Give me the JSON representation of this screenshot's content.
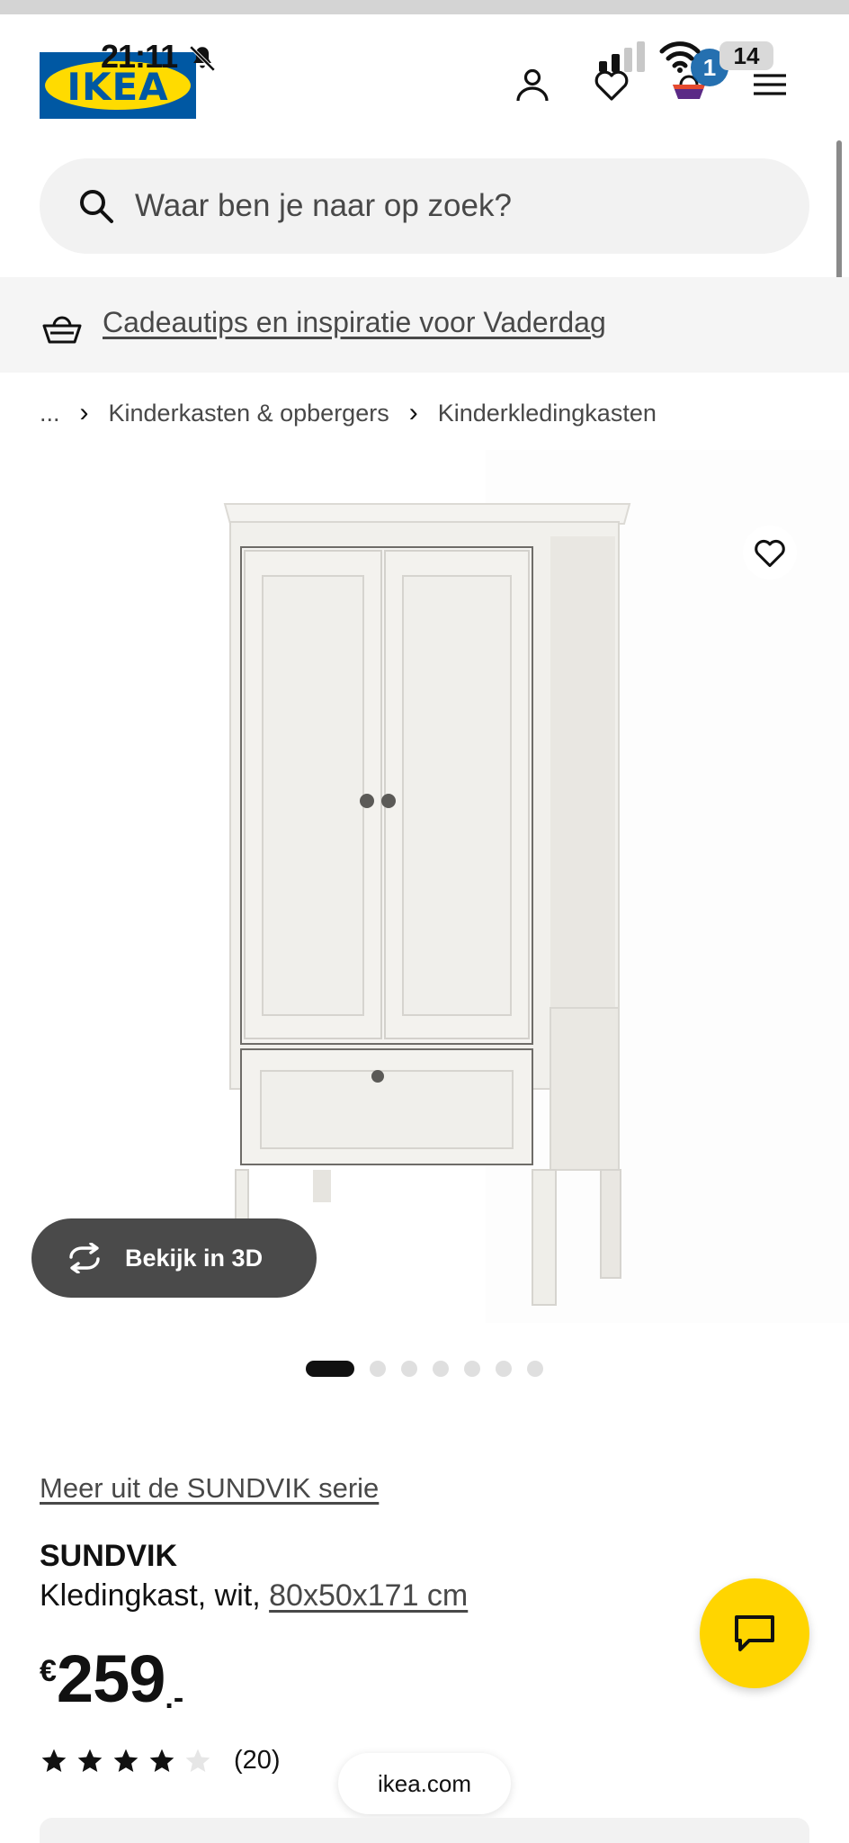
{
  "status_bar": {
    "time": "21:11",
    "battery": "14"
  },
  "header": {
    "logo_text": "IKEA",
    "cart_count": "1",
    "icons": [
      "account-icon",
      "heart-icon",
      "cart-icon",
      "menu-icon"
    ]
  },
  "search": {
    "placeholder": "Waar ben je naar op zoek?"
  },
  "promo": {
    "link": "Cadeautips en inspiratie voor Vaderdag"
  },
  "breadcrumb": {
    "ellipsis": "...",
    "items": [
      "Kinderkasten & opbergers",
      "Kinderkledingkasten"
    ]
  },
  "product": {
    "view_3d_label": "Bekijk in 3D",
    "image_count": 7,
    "active_image": 1,
    "series_link": "Meer uit de SUNDVIK serie",
    "name": "SUNDVIK",
    "description_prefix": "Kledingkast, wit, ",
    "dimensions": "80x50x171 cm",
    "price_currency": "€",
    "price_amount": "259",
    "price_suffix": ".-",
    "rating_value": 4,
    "rating_max": 5,
    "review_count": "(20)"
  },
  "browser": {
    "url": "ikea.com"
  },
  "colors": {
    "ikea_blue": "#0058a3",
    "ikea_yellow": "#ffdb00",
    "chat_yellow": "#ffd500"
  }
}
